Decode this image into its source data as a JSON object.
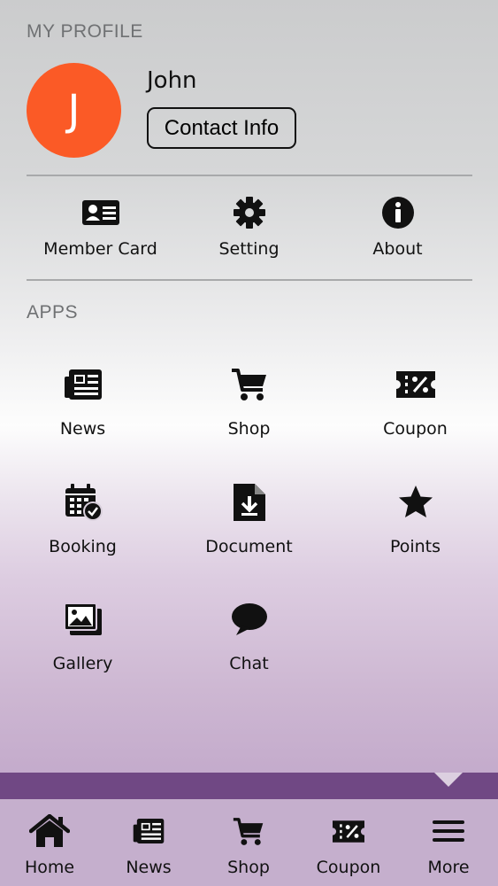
{
  "profile": {
    "section_title": "MY PROFILE",
    "avatar_letter": "J",
    "name": "John",
    "contact_label": "Contact Info"
  },
  "quick_actions": [
    {
      "label": "Member Card",
      "icon": "id-card-icon"
    },
    {
      "label": "Setting",
      "icon": "gear-icon"
    },
    {
      "label": "About",
      "icon": "info-icon"
    }
  ],
  "apps": {
    "section_title": "APPS",
    "items": [
      {
        "label": "News",
        "icon": "newspaper-icon"
      },
      {
        "label": "Shop",
        "icon": "cart-icon"
      },
      {
        "label": "Coupon",
        "icon": "coupon-icon"
      },
      {
        "label": "Booking",
        "icon": "calendar-check-icon"
      },
      {
        "label": "Document",
        "icon": "document-download-icon"
      },
      {
        "label": "Points",
        "icon": "star-icon"
      },
      {
        "label": "Gallery",
        "icon": "gallery-icon"
      },
      {
        "label": "Chat",
        "icon": "chat-bubble-icon"
      }
    ]
  },
  "tabbar": {
    "items": [
      {
        "label": "Home",
        "icon": "home-icon"
      },
      {
        "label": "News",
        "icon": "newspaper-icon"
      },
      {
        "label": "Shop",
        "icon": "cart-icon"
      },
      {
        "label": "Coupon",
        "icon": "coupon-icon"
      },
      {
        "label": "More",
        "icon": "menu-icon"
      }
    ],
    "active": "More"
  },
  "colors": {
    "avatar": "#fb5a26",
    "accent_bar": "#704884",
    "tabbar_bg": "#c5afcd"
  }
}
